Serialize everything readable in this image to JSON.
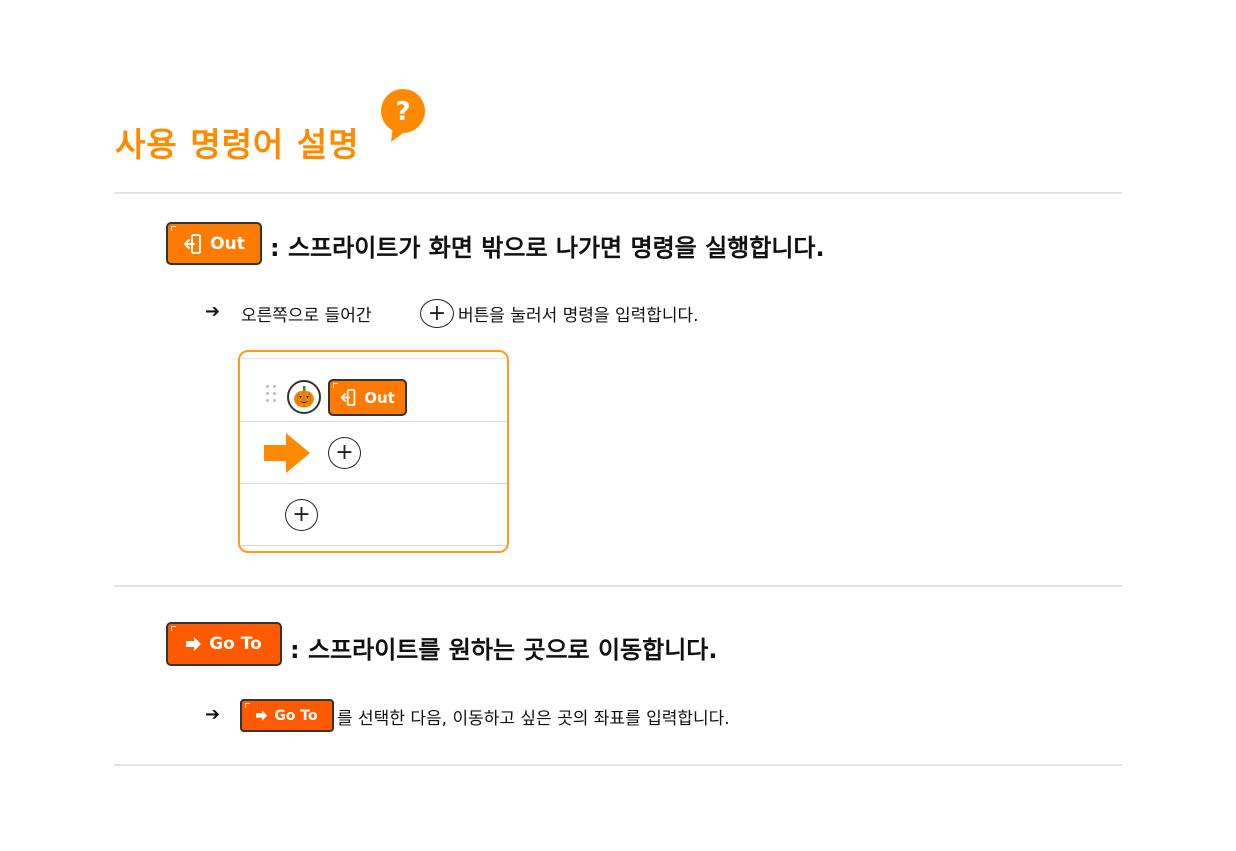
{
  "header": {
    "title": "사용 명령어 설명",
    "help_glyph": "?"
  },
  "colors": {
    "accent": "#ff8a00",
    "out_block": "#ff7a00",
    "goto_block": "#ff5a00",
    "divider": "#e2e2e2"
  },
  "section_out": {
    "block_label": "Out",
    "block_icon": "exit-door-icon",
    "heading": ": 스프라이트가 화면 밖으로 나가면 명령을 실행합니다.",
    "bullet": "➔",
    "step_before": "오른쪽으로 들어간",
    "step_after": "버튼을 눌러서 명령을 입력합니다.",
    "demo": {
      "sprite_icon": "pumpkin-icon",
      "block_label": "Out",
      "pointer_icon": "right-arrow-icon"
    }
  },
  "section_goto": {
    "block_label": "Go To",
    "block_icon": "right-arrow-icon",
    "heading": ": 스프라이트를 원하는 곳으로 이동합니다.",
    "bullet": "➔",
    "inline_block_label": "Go To",
    "step_after": "를 선택한 다음, 이동하고 싶은 곳의 좌표를 입력합니다."
  }
}
